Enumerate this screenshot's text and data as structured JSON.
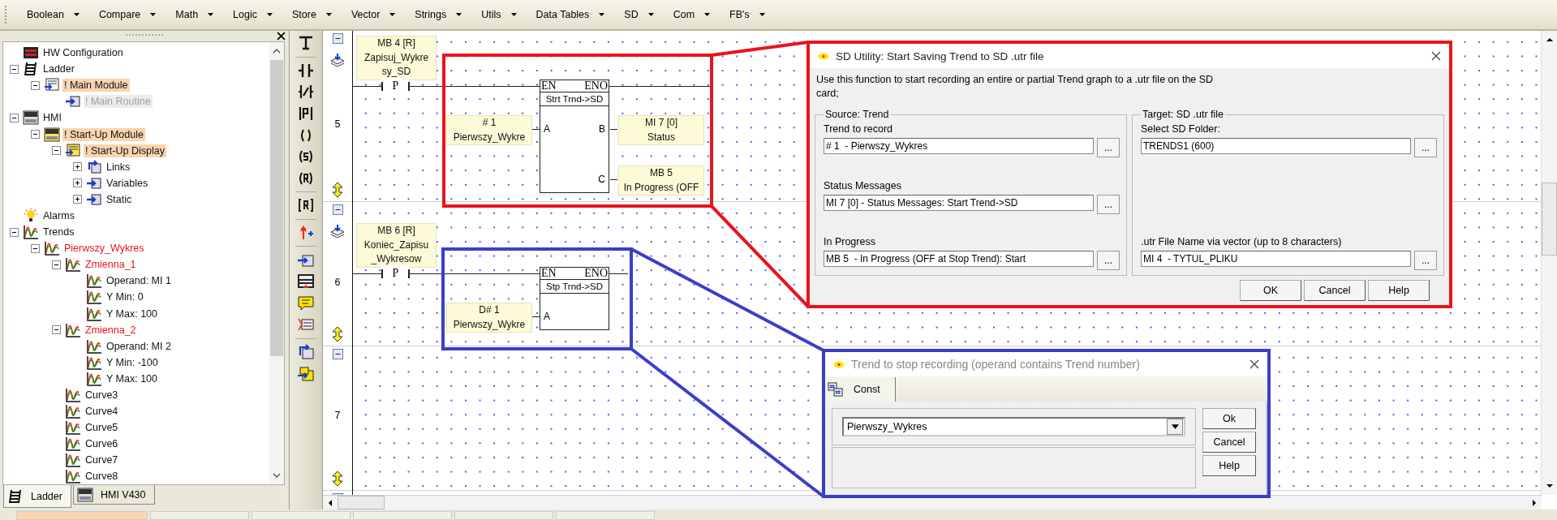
{
  "menu": [
    "Boolean",
    "Compare",
    "Math",
    "Logic",
    "Store",
    "Vector",
    "Strings",
    "Utils",
    "Data Tables",
    "SD",
    "Com",
    "FB's"
  ],
  "project_tree": [
    {
      "label": "HW Configuration",
      "kind": "hw",
      "highlighted": false,
      "disabled": false,
      "error": false
    },
    {
      "label": "Ladder",
      "kind": "ladder",
      "highlighted": false,
      "disabled": false,
      "error": false,
      "expanded": true,
      "children": [
        {
          "label": "! Main Module",
          "kind": "module",
          "highlighted": true,
          "disabled": false,
          "error": false,
          "expanded": true,
          "children": [
            {
              "label": "! Main Routine",
              "kind": "routine",
              "highlighted": false,
              "disabled": true,
              "error": false
            }
          ]
        }
      ]
    },
    {
      "label": "HMI",
      "kind": "hmi",
      "highlighted": false,
      "disabled": false,
      "error": false,
      "expanded": true,
      "children": [
        {
          "label": "! Start-Up Module",
          "kind": "hmi-module",
          "highlighted": true,
          "disabled": false,
          "error": false,
          "expanded": true,
          "children": [
            {
              "label": "! Start-Up Display",
              "kind": "display",
              "highlighted": true,
              "disabled": false,
              "error": false,
              "expanded": true,
              "children": [
                {
                  "label": "Links",
                  "kind": "links",
                  "highlighted": false,
                  "disabled": false,
                  "error": false,
                  "expanded": false
                },
                {
                  "label": "Variables",
                  "kind": "routine",
                  "highlighted": false,
                  "disabled": false,
                  "error": false,
                  "expanded": false
                },
                {
                  "label": "Static",
                  "kind": "routine",
                  "highlighted": false,
                  "disabled": false,
                  "error": false,
                  "expanded": false
                }
              ]
            }
          ]
        }
      ]
    },
    {
      "label": "Alarms",
      "kind": "alarm",
      "highlighted": false,
      "disabled": false,
      "error": false
    },
    {
      "label": "Trends",
      "kind": "trend",
      "highlighted": false,
      "disabled": false,
      "error": false,
      "expanded": true,
      "children": [
        {
          "label": "Pierwszy_Wykres",
          "kind": "trend",
          "highlighted": false,
          "disabled": false,
          "error": true,
          "expanded": true,
          "children": [
            {
              "label": "Zmienna_1",
              "kind": "trend",
              "highlighted": false,
              "disabled": false,
              "error": true,
              "expanded": true,
              "children": [
                {
                  "label": "Operand: MI 1",
                  "kind": "trend",
                  "highlighted": false,
                  "disabled": false,
                  "error": false
                },
                {
                  "label": "Y Min: 0",
                  "kind": "trend",
                  "highlighted": false,
                  "disabled": false,
                  "error": false
                },
                {
                  "label": "Y Max: 100",
                  "kind": "trend",
                  "highlighted": false,
                  "disabled": false,
                  "error": false
                }
              ]
            },
            {
              "label": "Zmienna_2",
              "kind": "trend",
              "highlighted": false,
              "disabled": false,
              "error": true,
              "expanded": true,
              "children": [
                {
                  "label": "Operand: MI 2",
                  "kind": "trend",
                  "highlighted": false,
                  "disabled": false,
                  "error": false
                },
                {
                  "label": "Y Min: -100",
                  "kind": "trend",
                  "highlighted": false,
                  "disabled": false,
                  "error": false
                },
                {
                  "label": "Y Max: 100",
                  "kind": "trend",
                  "highlighted": false,
                  "disabled": false,
                  "error": false
                }
              ]
            },
            {
              "label": "Curve3",
              "kind": "trend",
              "highlighted": false,
              "disabled": false,
              "error": false
            },
            {
              "label": "Curve4",
              "kind": "trend",
              "highlighted": false,
              "disabled": false,
              "error": false
            },
            {
              "label": "Curve5",
              "kind": "trend",
              "highlighted": false,
              "disabled": false,
              "error": false
            },
            {
              "label": "Curve6",
              "kind": "trend",
              "highlighted": false,
              "disabled": false,
              "error": false
            },
            {
              "label": "Curve7",
              "kind": "trend",
              "highlighted": false,
              "disabled": false,
              "error": false
            },
            {
              "label": "Curve8",
              "kind": "trend",
              "highlighted": false,
              "disabled": false,
              "error": false
            }
          ]
        }
      ]
    }
  ],
  "panel_tabs": [
    {
      "label": "Ladder",
      "kind": "ladder",
      "selected": true
    },
    {
      "label": "HMI V430",
      "kind": "hmi",
      "selected": false
    }
  ],
  "rungs": [
    {
      "number": "5",
      "condition": {
        "lines": [
          "MB 4 [R]",
          "Zapisuj_Wykre",
          "sy_SD"
        ],
        "contact": "P"
      },
      "block": {
        "en": "EN",
        "eno": "ENO",
        "title": "Strt Trnd->SD",
        "inputs": [
          {
            "pin": "A",
            "lines": [
              "# 1",
              "Pierwszy_Wykre"
            ]
          }
        ],
        "outputs": [
          {
            "pin": "B",
            "lines": [
              "MI 7 [0]",
              "Status"
            ]
          },
          {
            "pin": "C",
            "lines": [
              "MB 5",
              "In Progress (OFF"
            ]
          }
        ]
      }
    },
    {
      "number": "6",
      "condition": {
        "lines": [
          "MB 6 [R]",
          "Koniec_Zapisu",
          "_Wykresow"
        ],
        "contact": "P"
      },
      "block": {
        "en": "EN",
        "eno": "ENO",
        "title": "Stp Trnd->SD",
        "inputs": [
          {
            "pin": "A",
            "lines": [
              "D# 1",
              "Pierwszy_Wykre"
            ]
          }
        ]
      }
    },
    {
      "number": "7"
    }
  ],
  "sd_dialog": {
    "title": "SD Utility: Start Saving Trend to SD .utr file",
    "description_lines": [
      "Use this function to start recording an entire or partial Trend graph to a .utr file on the SD",
      "card;"
    ],
    "groups": [
      {
        "title": "Source: Trend",
        "fields": [
          {
            "label": "Trend to record",
            "value": "# 1  - Pierwszy_Wykres",
            "browse": "..."
          },
          {
            "label": "Status Messages",
            "value": "MI 7 [0] - Status Messages: Start Trend->SD",
            "browse": "..."
          },
          {
            "label": "In Progress",
            "value": "MB 5  - In Progress (OFF at Stop Trend): Start",
            "browse": "..."
          }
        ]
      },
      {
        "title": "Target: SD .utr file",
        "fields": [
          {
            "label": "Select SD Folder:",
            "value": "TRENDS1 (600)",
            "browse": "..."
          },
          {
            "label": ".utr File Name via vector (up to 8 characters)",
            "value": "MI 4  - TYTUL_PLIKU",
            "browse": "..."
          }
        ]
      }
    ],
    "buttons": [
      "OK",
      "Cancel",
      "Help"
    ]
  },
  "trend_dialog": {
    "title": "Trend to stop recording (operand contains Trend number)",
    "tabs": [
      {
        "label": "Const",
        "selected": true
      }
    ],
    "value": "Pierwszy_Wykres",
    "buttons": [
      "Ok",
      "Cancel",
      "Help"
    ]
  }
}
